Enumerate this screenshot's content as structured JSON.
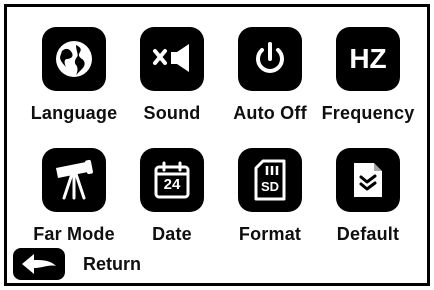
{
  "menu": {
    "items": [
      {
        "label": "Language",
        "icon": "globe-icon"
      },
      {
        "label": "Sound",
        "icon": "sound-mute-icon"
      },
      {
        "label": "Auto Off",
        "icon": "power-icon"
      },
      {
        "label": "Frequency",
        "icon": "hz-icon",
        "icon_text": "HZ"
      },
      {
        "label": "Far Mode",
        "icon": "telescope-icon"
      },
      {
        "label": "Date",
        "icon": "calendar-icon",
        "icon_text": "24"
      },
      {
        "label": "Format",
        "icon": "sd-card-icon",
        "icon_text": "SD"
      },
      {
        "label": "Default",
        "icon": "reset-document-icon"
      }
    ]
  },
  "footer": {
    "return_label": "Return",
    "return_icon": "back-arrow-icon"
  }
}
